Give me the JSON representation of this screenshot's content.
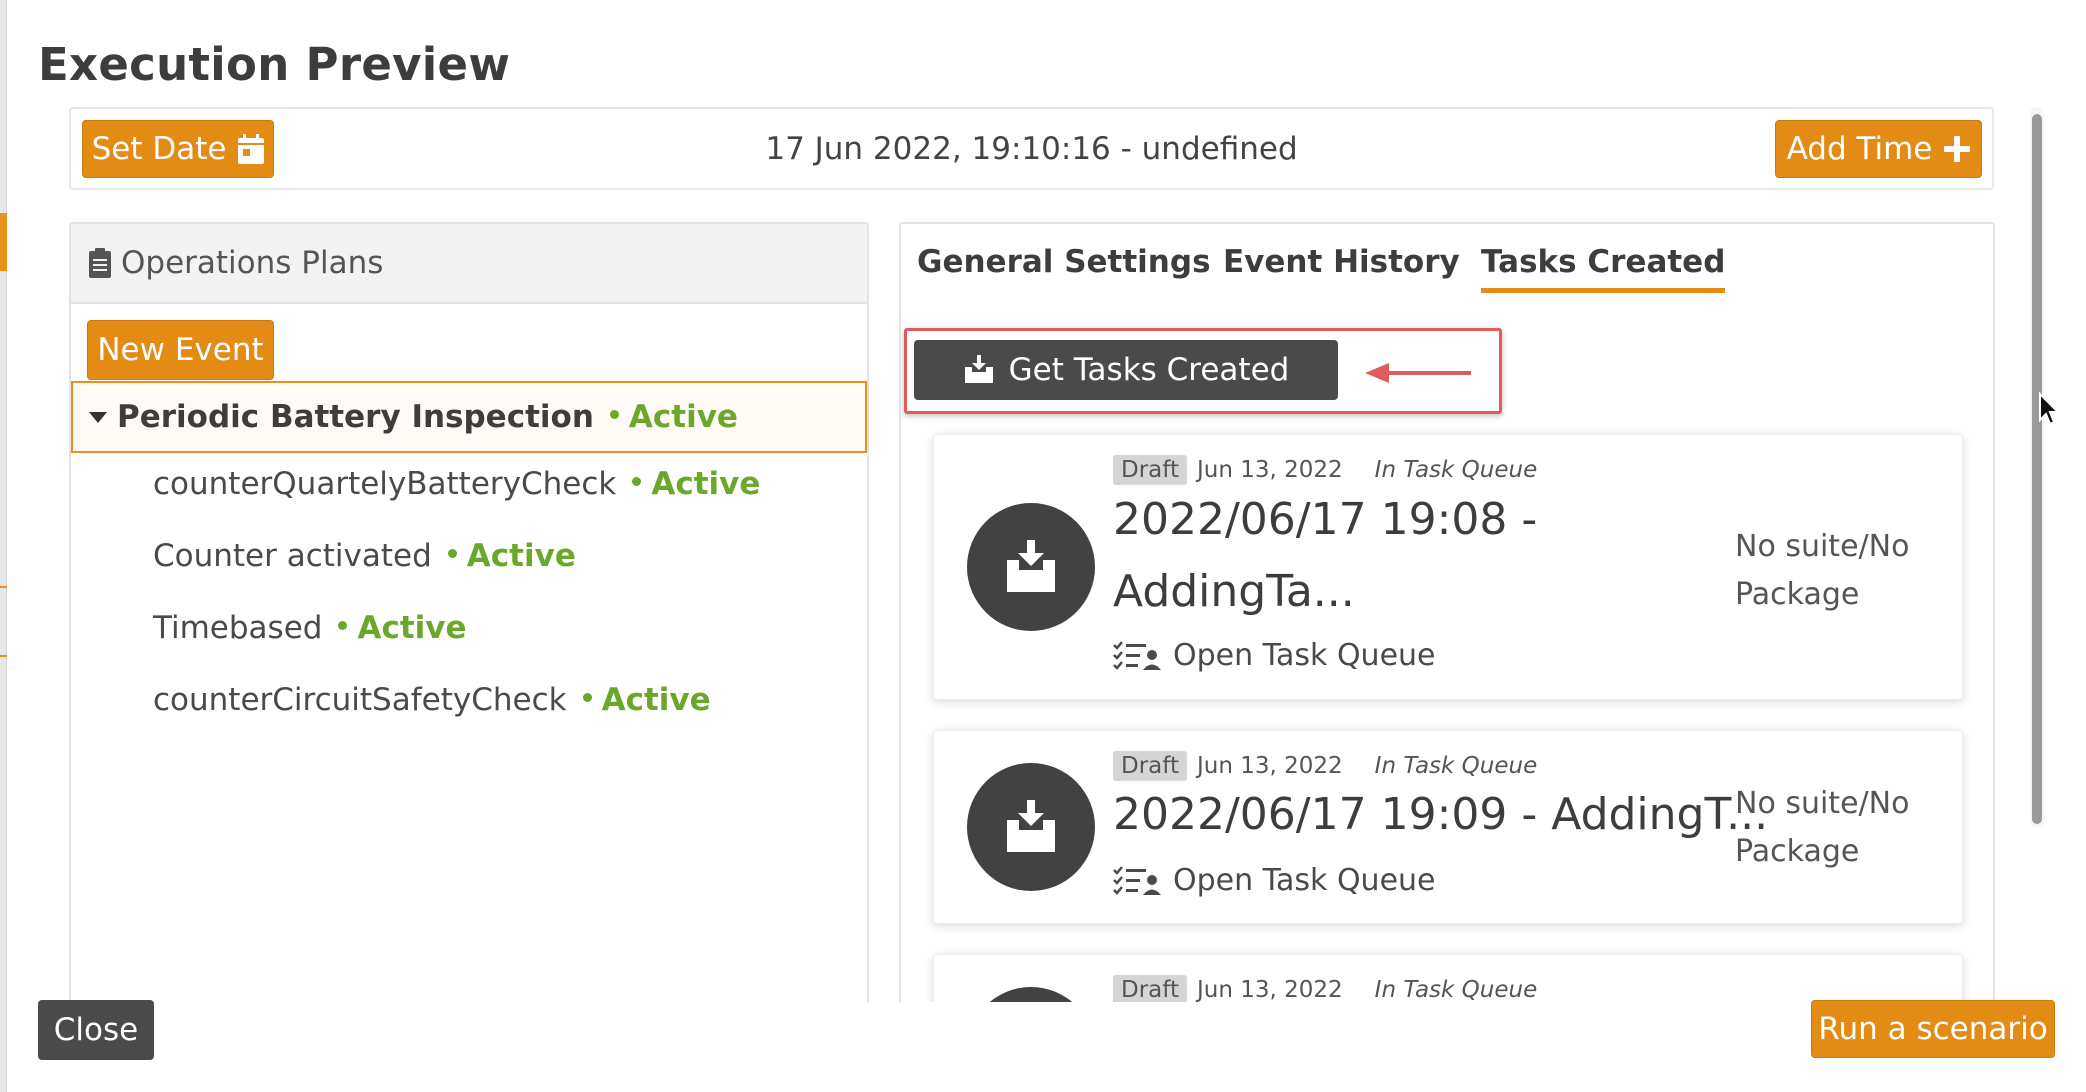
{
  "modal": {
    "title": "Execution Preview"
  },
  "toolbar": {
    "set_date_label": "Set Date",
    "date_display": "17 Jun 2022, 19:10:16 - undefined",
    "add_time_label": "Add Time"
  },
  "operations": {
    "header": "Operations Plans",
    "new_event_label": "New Event",
    "plan": {
      "name": "Periodic Battery Inspection",
      "status": "Active"
    },
    "events": [
      {
        "name": "counterQuartelyBatteryCheck",
        "status": "Active"
      },
      {
        "name": "Counter activated",
        "status": "Active"
      },
      {
        "name": "Timebased",
        "status": "Active"
      },
      {
        "name": "counterCircuitSafetyCheck",
        "status": "Active"
      }
    ]
  },
  "tabs": {
    "general": "General Settings",
    "history": "Event History",
    "tasks": "Tasks Created",
    "active": "Tasks Created"
  },
  "tasks_panel": {
    "get_tasks_label": "Get Tasks Created",
    "cards": [
      {
        "badge": "Draft",
        "date": "Jun 13, 2022",
        "queue_state": "In Task Queue",
        "title_line1": "2022/06/17 19:08 -",
        "title_line2": "AddingTa...",
        "link": "Open Task Queue",
        "suite_line1": "No suite/No",
        "suite_line2": "Package"
      },
      {
        "badge": "Draft",
        "date": "Jun 13, 2022",
        "queue_state": "In Task Queue",
        "title_line1": "2022/06/17 19:09 - AddingT...",
        "link": "Open Task Queue",
        "suite_line1": "No suite/No",
        "suite_line2": "Package"
      },
      {
        "badge": "Draft",
        "date": "Jun 13, 2022",
        "queue_state": "In Task Queue"
      }
    ]
  },
  "footer": {
    "close_label": "Close",
    "run_label": "Run a scenario"
  },
  "colors": {
    "accent": "#e38b15",
    "dark_button": "#4a4a4a",
    "active_status": "#6aa72b",
    "highlight": "#e05b5b"
  },
  "icons": [
    "calendar-icon",
    "plus-icon",
    "clipboard-icon",
    "caret-down-icon",
    "inbox-download-icon",
    "task-list-icon",
    "arrow-left-icon",
    "mouse-pointer-icon"
  ]
}
